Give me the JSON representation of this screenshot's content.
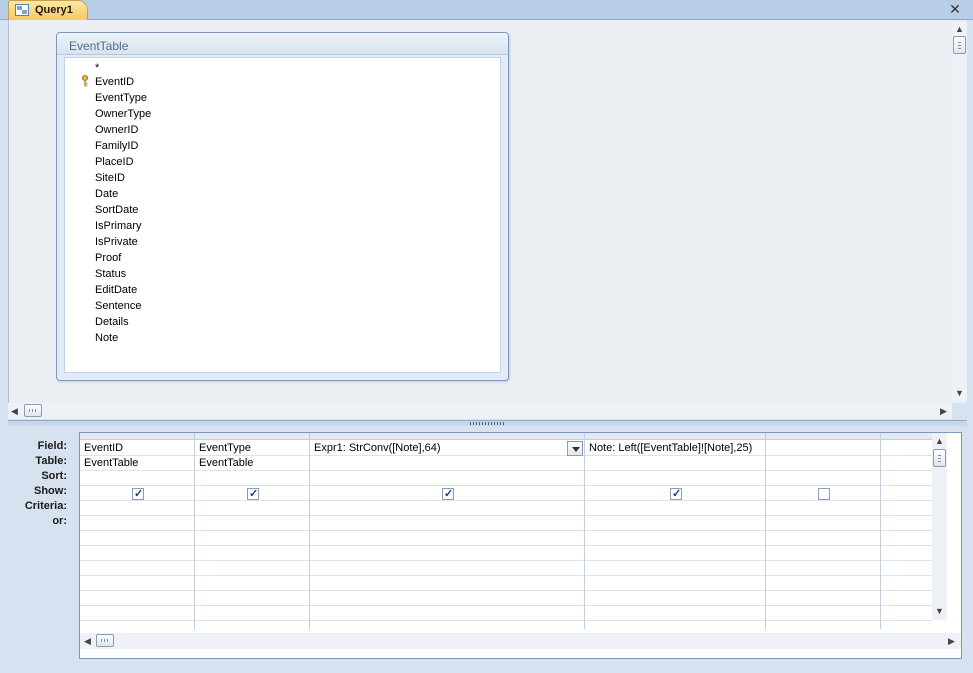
{
  "tab": {
    "title": "Query1"
  },
  "table": {
    "name": "EventTable",
    "fields": [
      "*",
      "EventID",
      "EventType",
      "OwnerType",
      "OwnerID",
      "FamilyID",
      "PlaceID",
      "SiteID",
      "Date",
      "SortDate",
      "IsPrimary",
      "IsPrivate",
      "Proof",
      "Status",
      "EditDate",
      "Sentence",
      "Details",
      "Note"
    ],
    "primary_key": "EventID"
  },
  "grid": {
    "row_labels": [
      "Field:",
      "Table:",
      "Sort:",
      "Show:",
      "Criteria:",
      "or:"
    ],
    "columns": [
      {
        "field": "EventID",
        "table": "EventTable",
        "show": true
      },
      {
        "field": "EventType",
        "table": "EventTable",
        "show": true
      },
      {
        "field": "Expr1: StrConv([Note],64)",
        "table": "",
        "show": true
      },
      {
        "field": "Note: Left([EventTable]![Note],25)",
        "table": "",
        "show": true
      },
      {
        "field": "",
        "table": "",
        "show": false
      },
      {
        "field": "",
        "table": "",
        "show": false
      }
    ]
  },
  "icons": {
    "tab": "query-icon",
    "close": "close-icon",
    "key": "primary-key-icon",
    "dropdown": "chevron-down-icon"
  }
}
